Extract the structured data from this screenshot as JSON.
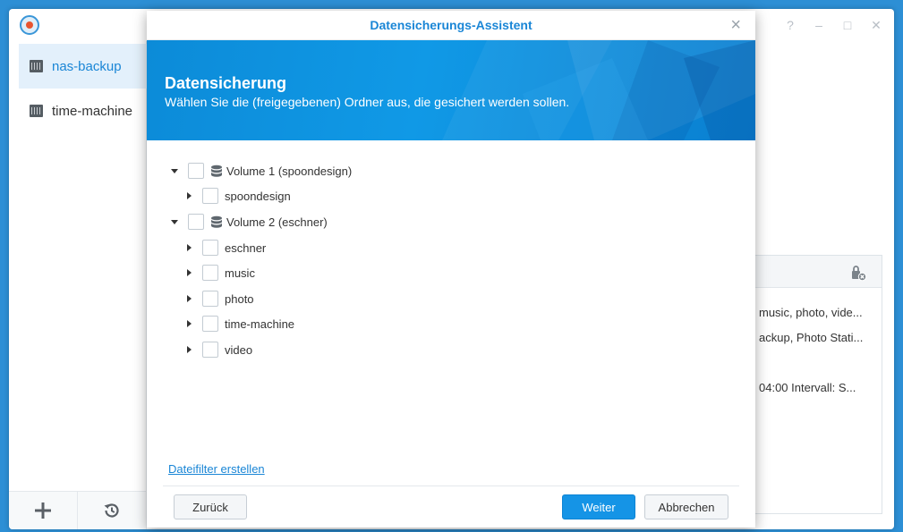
{
  "app": {
    "sidebar": {
      "items": [
        {
          "label": "nas-backup",
          "active": true
        },
        {
          "label": "time-machine",
          "active": false
        }
      ]
    },
    "window_controls": [
      "?",
      "–",
      "□",
      "✕"
    ],
    "background_panel": {
      "lines": [
        "music, photo, vide...",
        "ackup, Photo Stati...",
        "04:00 Intervall: S..."
      ]
    }
  },
  "modal": {
    "title": "Datensicherungs-Assistent",
    "close_label": "×",
    "banner": {
      "title": "Datensicherung",
      "subtitle": "Wählen Sie die (freigegebenen) Ordner aus, die gesichert werden sollen."
    },
    "tree": [
      {
        "label": "Volume 1 (spoondesign)",
        "level": 0,
        "expanded": true,
        "icon": "database-icon"
      },
      {
        "label": "spoondesign",
        "level": 1,
        "expanded": false
      },
      {
        "label": "Volume 2 (eschner)",
        "level": 0,
        "expanded": true,
        "icon": "database-icon"
      },
      {
        "label": "eschner",
        "level": 1,
        "expanded": false
      },
      {
        "label": "music",
        "level": 1,
        "expanded": false
      },
      {
        "label": "photo",
        "level": 1,
        "expanded": false
      },
      {
        "label": "time-machine",
        "level": 1,
        "expanded": false
      },
      {
        "label": "video",
        "level": 1,
        "expanded": false
      }
    ],
    "filter_link": "Dateifilter erstellen",
    "buttons": {
      "back": "Zurück",
      "next": "Weiter",
      "cancel": "Abbrechen"
    }
  },
  "colors": {
    "accent": "#1a86d6",
    "desktop": "#2d8fd5",
    "primary_button": "#1594e6"
  }
}
